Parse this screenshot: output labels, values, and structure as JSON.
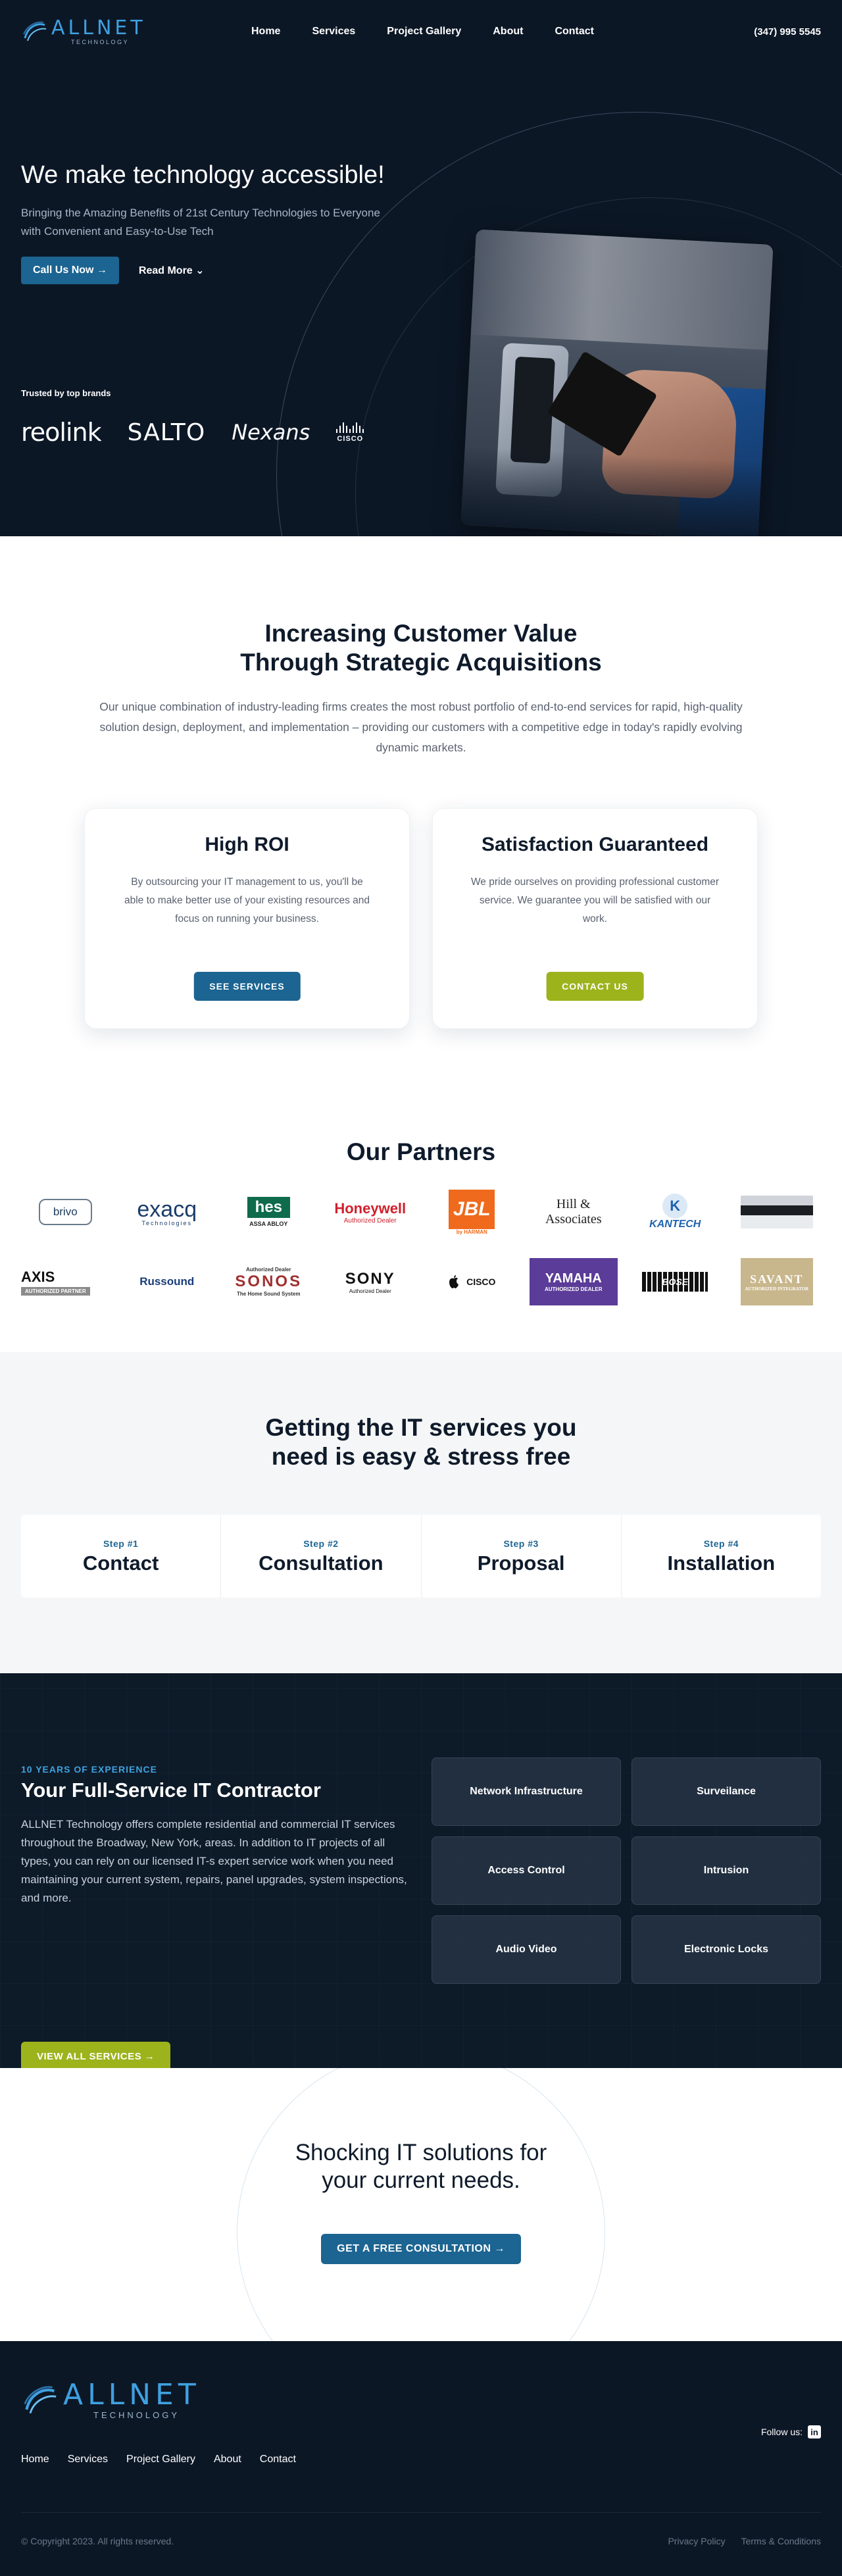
{
  "brand": {
    "name": "ALLNET",
    "tagline": "TECHNOLOGY",
    "accent": "#3fa0e0"
  },
  "nav": {
    "items": [
      "Home",
      "Services",
      "Project Gallery",
      "About",
      "Contact"
    ],
    "phone": "(347) 995 5545"
  },
  "hero": {
    "title": "We make technology accessible!",
    "subtitle": "Bringing the Amazing Benefits of 21st Century Technologies to Everyone with Convenient and Easy-to-Use Tech",
    "cta_primary": "Call Us Now →",
    "cta_secondary": "Read More ⌄",
    "trusted_label": "Trusted by top brands",
    "brands": [
      "reolink",
      "SALTO",
      "Nexans",
      "CISCO"
    ]
  },
  "value": {
    "title_line1": "Increasing Customer Value",
    "title_line2": "Through Strategic Acquisitions",
    "text": "Our unique combination of industry-leading firms creates the most robust portfolio of end-to-end services for rapid, high-quality solution design, deployment, and implementation – providing our customers with a competitive edge in today's rapidly evolving dynamic markets.",
    "cards": [
      {
        "title": "High ROI",
        "text": "By outsourcing your IT management to us, you'll be able to make better use of your existing resources and focus on running your business.",
        "button": "SEE SERVICES"
      },
      {
        "title": "Satisfaction Guaranteed",
        "text": "We pride ourselves on providing professional customer service. We guarantee you will be satisfied with our work.",
        "button": "CONTACT US"
      }
    ]
  },
  "partners": {
    "title": "Our Partners",
    "logos": {
      "brivo": "brivo",
      "exacq": "exacq",
      "exacq_sub": "Technologies",
      "hes": "hes",
      "hes_sub": "ASSA ABLOY",
      "honeywell": "Honeywell",
      "honeywell_sub": "Authorized Dealer",
      "jbl": "JBL",
      "jbl_sub": "by HARMAN",
      "hills": "Hill & Associates",
      "kantech": "KANTECH",
      "kantech_badge": "K",
      "axis": "AXIS",
      "axis_sub": "AUTHORIZED PARTNER",
      "russound": "Russound",
      "sonos": "SONOS",
      "sonos_pre": "Authorized Dealer",
      "sonos_sub": "The Home Sound System",
      "sony": "SONY",
      "sony_sub": "Authorized Dealer",
      "cisco": "CISCO",
      "yamaha": "YAMAHA",
      "yamaha_sub": "AUTHORIZED DEALER",
      "bose": "BOSE",
      "savant": "SAVANT",
      "savant_sub": "AUTHORIZED INTEGRATOR"
    }
  },
  "steps": {
    "title_line1": "Getting the IT services you",
    "title_line2": "need is easy & stress free",
    "items": [
      {
        "num": "Step #1",
        "name": "Contact"
      },
      {
        "num": "Step #2",
        "name": "Consultation"
      },
      {
        "num": "Step #3",
        "name": "Proposal"
      },
      {
        "num": "Step #4",
        "name": "Installation"
      }
    ]
  },
  "services": {
    "eyebrow": "10 YEARS OF EXPERIENCE",
    "title": "Your Full-Service IT Contractor",
    "text": "ALLNET Technology offers complete residential and commercial IT services throughout the Broadway, New York, areas. In addition to IT projects of all types, you can rely on our licensed IT-s expert service work when you need maintaining your current system, repairs, panel upgrades, system inspections, and more.",
    "button": "VIEW ALL SERVICES  →",
    "tiles": [
      "Network Infrastructure",
      "Surveilance",
      "Access Control",
      "Intrusion",
      "Audio Video",
      "Electronic Locks"
    ]
  },
  "cta": {
    "title_line1": "Shocking IT solutions for",
    "title_line2": "your current needs.",
    "button": "GET A FREE CONSULTATION  →"
  },
  "footer": {
    "follow": "Follow us:",
    "linkedin": "in",
    "nav": [
      "Home",
      "Services",
      "Project Gallery",
      "About",
      "Contact"
    ],
    "copyright": "© Copyright 2023. All rights reserved.",
    "legal": [
      "Privacy Policy",
      "Terms & Conditions"
    ]
  }
}
